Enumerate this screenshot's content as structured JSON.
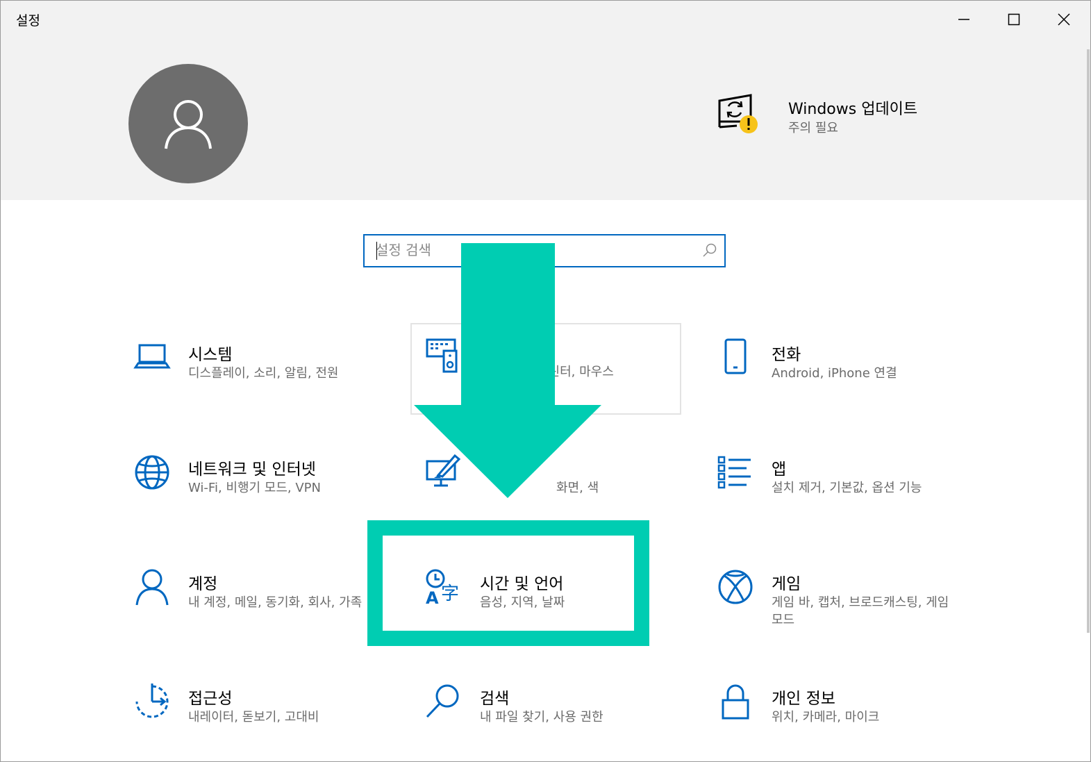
{
  "window": {
    "title": "설정"
  },
  "titlebar_buttons": {
    "minimize_icon": "minimize-icon",
    "maximize_icon": "maximize-icon",
    "close_icon": "close-icon"
  },
  "profile": {
    "avatar_icon": "user-icon"
  },
  "update": {
    "title": "Windows 업데이트",
    "status": "주의 필요",
    "icon": "windows-update-warning-icon"
  },
  "search": {
    "placeholder": "설정 검색",
    "icon": "search-icon"
  },
  "categories": [
    {
      "icon": "laptop-icon",
      "title": "시스템",
      "desc": "디스플레이, 소리, 알림, 전원"
    },
    {
      "icon": "devices-icon",
      "title": "",
      "desc": "프린터, 마우스"
    },
    {
      "icon": "phone-icon",
      "title": "전화",
      "desc": "Android, iPhone 연결"
    },
    {
      "icon": "globe-icon",
      "title": "네트워크 및 인터넷",
      "desc": "Wi-Fi, 비행기 모드, VPN"
    },
    {
      "icon": "personalization-icon",
      "title": "",
      "desc": "화면, 색"
    },
    {
      "icon": "apps-list-icon",
      "title": "앱",
      "desc": "설치 제거, 기본값, 옵션 기능"
    },
    {
      "icon": "account-icon",
      "title": "계정",
      "desc": "내 계정, 메일, 동기화, 회사, 가족"
    },
    {
      "icon": "time-language-icon",
      "title": "시간 및 언어",
      "desc": "음성, 지역, 날짜"
    },
    {
      "icon": "xbox-icon",
      "title": "게임",
      "desc": "게임 바, 캡처, 브로드캐스팅, 게임 모드"
    },
    {
      "icon": "accessibility-icon",
      "title": "접근성",
      "desc": "내레이터, 돋보기, 고대비"
    },
    {
      "icon": "search-icon",
      "title": "검색",
      "desc": "내 파일 찾기, 사용 권한"
    },
    {
      "icon": "lock-icon",
      "title": "개인 정보",
      "desc": "위치, 카메라, 마이크"
    }
  ],
  "overlay": {
    "arrow_icon": "down-arrow-icon",
    "highlight_target": "시간 및 언어",
    "color": "#00cdb2"
  },
  "colors": {
    "accent": "#0067c0",
    "header_bg": "#f2f2f2",
    "avatar_bg": "#6d6d6d",
    "warning": "#f7c31a"
  }
}
